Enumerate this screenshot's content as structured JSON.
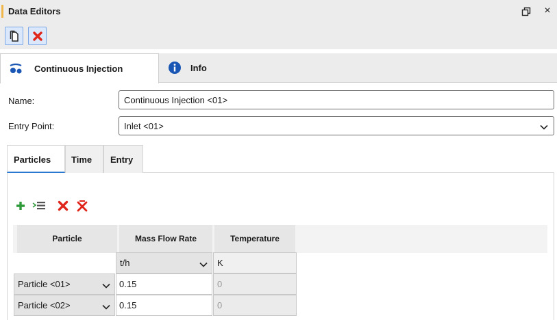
{
  "window": {
    "title": "Data Editors",
    "restore_icon": "restore-window-icon",
    "close_glyph": "×"
  },
  "toolbar": {
    "new_icon": "new-document-icon",
    "delete_icon": "delete-red-x-icon",
    "delete_color": "#e0261b",
    "accent_color": "#7aa7e6"
  },
  "main_tabs": [
    {
      "label": "Continuous Injection",
      "icon": "particles-icon",
      "active": true
    },
    {
      "label": "Info",
      "icon": "info-icon",
      "active": false
    }
  ],
  "form": {
    "name_label": "Name:",
    "name_value": "Continuous Injection <01>",
    "entry_label": "Entry Point:",
    "entry_value": "Inlet <01>"
  },
  "sub_tabs": [
    {
      "label": "Particles",
      "active": true
    },
    {
      "label": "Time",
      "active": false
    },
    {
      "label": "Entry",
      "active": false
    }
  ],
  "grid_toolbar": {
    "add_icon": "add-green-plus-icon",
    "insert_icon": "insert-rows-icon",
    "remove_icon": "remove-red-x-icon",
    "remove_all_icon": "remove-all-icon"
  },
  "grid": {
    "columns": [
      "Particle",
      "Mass Flow Rate",
      "Temperature"
    ],
    "units": {
      "mass_flow": "t/h",
      "temperature": "K"
    },
    "rows": [
      {
        "particle": "Particle <01>",
        "mass_flow": "0.15",
        "temperature": "0"
      },
      {
        "particle": "Particle <02>",
        "mass_flow": "0.15",
        "temperature": "0"
      }
    ]
  }
}
